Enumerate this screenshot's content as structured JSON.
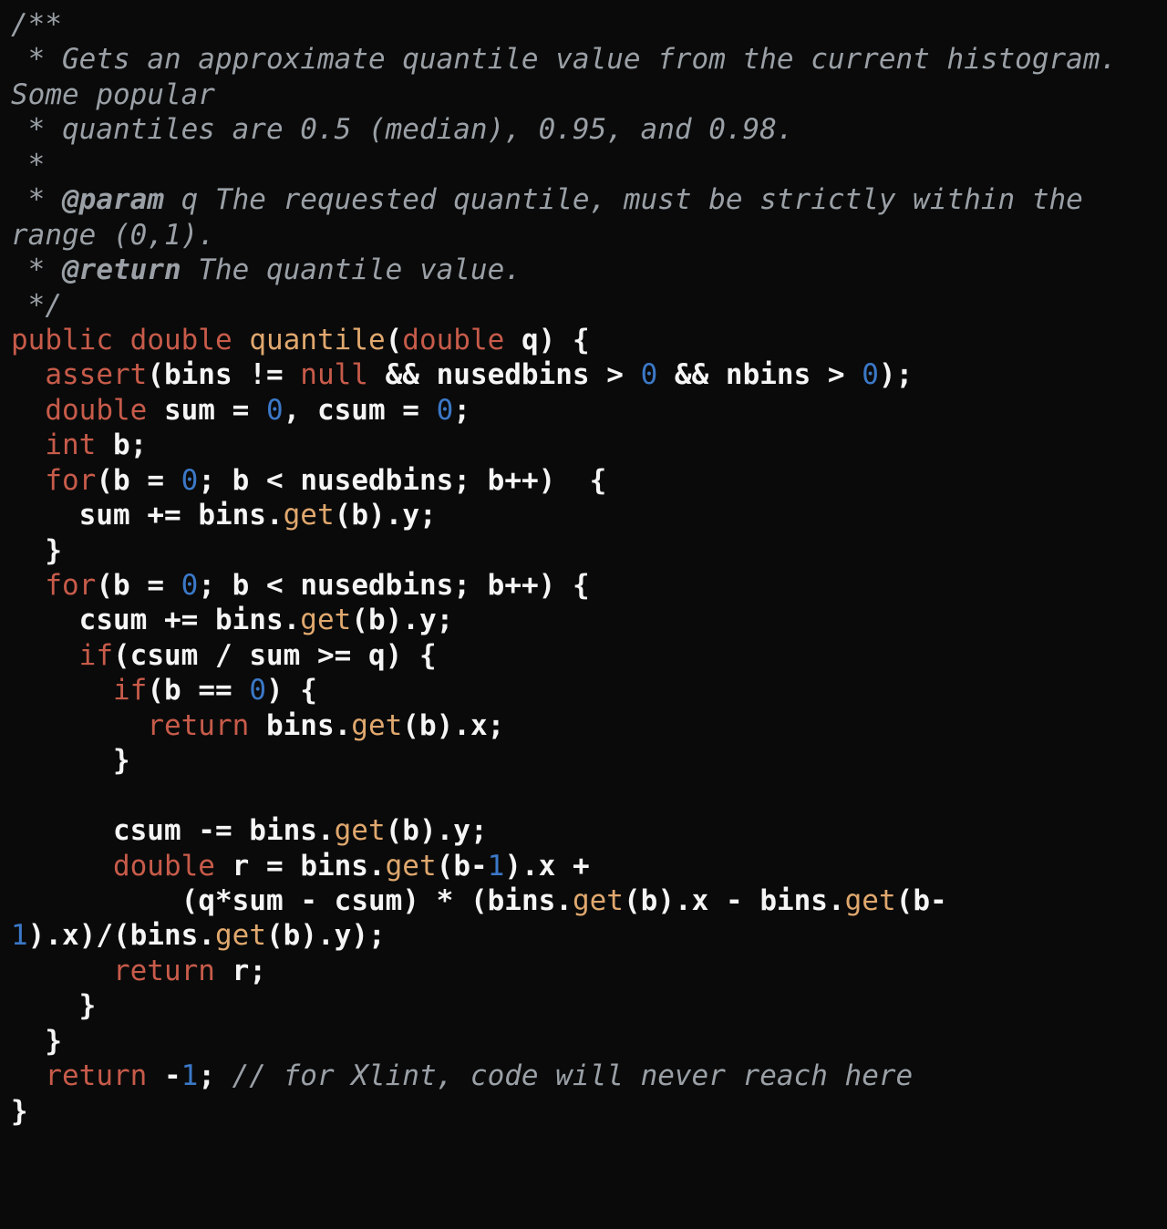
{
  "code": {
    "lang": "java",
    "theme": "dark",
    "colors": {
      "background": "#0a0a0a",
      "foreground": "#f5f5f5",
      "comment": "#9aa0a6",
      "keyword": "#c75b4a",
      "function": "#e0a86e",
      "number": "#3b78c7"
    },
    "source": "/**\n * Gets an approximate quantile value from the current histogram. Some popular\n * quantiles are 0.5 (median), 0.95, and 0.98.\n *\n * @param q The requested quantile, must be strictly within the range (0,1).\n * @return The quantile value.\n */\npublic double quantile(double q) {\n  assert(bins != null && nusedbins > 0 && nbins > 0);\n  double sum = 0, csum = 0;\n  int b;\n  for(b = 0; b < nusedbins; b++)  {\n    sum += bins.get(b).y;\n  }\n  for(b = 0; b < nusedbins; b++) {\n    csum += bins.get(b).y;\n    if(csum / sum >= q) {\n      if(b == 0) {\n        return bins.get(b).x;\n      }\n\n      csum -= bins.get(b).y;\n      double r = bins.get(b-1).x +\n          (q*sum - csum) * (bins.get(b).x - bins.get(b-1).x)/(bins.get(b).y);\n      return r;\n    }\n  }\n  return -1; // for Xlint, code will never reach here\n}",
    "tokens": [
      {
        "t": "/**",
        "c": "comment"
      },
      {
        "nl": 1
      },
      {
        "t": " * Gets an approximate quantile value from the current histogram. Some popular",
        "c": "comment"
      },
      {
        "nl": 1
      },
      {
        "t": " * quantiles are 0.5 (median), 0.95, and 0.98.",
        "c": "comment"
      },
      {
        "nl": 1
      },
      {
        "t": " *",
        "c": "comment"
      },
      {
        "nl": 1
      },
      {
        "t": " * ",
        "c": "comment"
      },
      {
        "t": "@param",
        "c": "tag"
      },
      {
        "t": " q The requested quantile, must be strictly within the range (0,1).",
        "c": "comment"
      },
      {
        "nl": 1
      },
      {
        "t": " * ",
        "c": "comment"
      },
      {
        "t": "@return",
        "c": "tag"
      },
      {
        "t": " The quantile value.",
        "c": "comment"
      },
      {
        "nl": 1
      },
      {
        "t": " */",
        "c": "comment"
      },
      {
        "nl": 1
      },
      {
        "t": "public",
        "c": "kw"
      },
      {
        "t": " ",
        "c": "plain"
      },
      {
        "t": "double",
        "c": "kw"
      },
      {
        "t": " ",
        "c": "plain"
      },
      {
        "t": "quantile",
        "c": "fn"
      },
      {
        "t": "(",
        "c": "op"
      },
      {
        "t": "double",
        "c": "kw"
      },
      {
        "t": " ",
        "c": "plain"
      },
      {
        "t": "q",
        "c": "id"
      },
      {
        "t": ") {",
        "c": "op"
      },
      {
        "nl": 1
      },
      {
        "t": "  ",
        "c": "plain"
      },
      {
        "t": "assert",
        "c": "kw"
      },
      {
        "t": "(",
        "c": "op"
      },
      {
        "t": "bins",
        "c": "id"
      },
      {
        "t": " != ",
        "c": "op"
      },
      {
        "t": "null",
        "c": "null"
      },
      {
        "t": " && ",
        "c": "op"
      },
      {
        "t": "nusedbins",
        "c": "id"
      },
      {
        "t": " > ",
        "c": "op"
      },
      {
        "t": "0",
        "c": "num"
      },
      {
        "t": " && ",
        "c": "op"
      },
      {
        "t": "nbins",
        "c": "id"
      },
      {
        "t": " > ",
        "c": "op"
      },
      {
        "t": "0",
        "c": "num"
      },
      {
        "t": ");",
        "c": "op"
      },
      {
        "nl": 1
      },
      {
        "t": "  ",
        "c": "plain"
      },
      {
        "t": "double",
        "c": "kw"
      },
      {
        "t": " ",
        "c": "plain"
      },
      {
        "t": "sum",
        "c": "id"
      },
      {
        "t": " = ",
        "c": "op"
      },
      {
        "t": "0",
        "c": "num"
      },
      {
        "t": ", ",
        "c": "op"
      },
      {
        "t": "csum",
        "c": "id"
      },
      {
        "t": " = ",
        "c": "op"
      },
      {
        "t": "0",
        "c": "num"
      },
      {
        "t": ";",
        "c": "op"
      },
      {
        "nl": 1
      },
      {
        "t": "  ",
        "c": "plain"
      },
      {
        "t": "int",
        "c": "kw"
      },
      {
        "t": " ",
        "c": "plain"
      },
      {
        "t": "b",
        "c": "id"
      },
      {
        "t": ";",
        "c": "op"
      },
      {
        "nl": 1
      },
      {
        "t": "  ",
        "c": "plain"
      },
      {
        "t": "for",
        "c": "kw"
      },
      {
        "t": "(",
        "c": "op"
      },
      {
        "t": "b",
        "c": "id"
      },
      {
        "t": " = ",
        "c": "op"
      },
      {
        "t": "0",
        "c": "num"
      },
      {
        "t": "; ",
        "c": "op"
      },
      {
        "t": "b",
        "c": "id"
      },
      {
        "t": " < ",
        "c": "op"
      },
      {
        "t": "nusedbins",
        "c": "id"
      },
      {
        "t": "; ",
        "c": "op"
      },
      {
        "t": "b",
        "c": "id"
      },
      {
        "t": "++)  {",
        "c": "op"
      },
      {
        "nl": 1
      },
      {
        "t": "    ",
        "c": "plain"
      },
      {
        "t": "sum",
        "c": "id"
      },
      {
        "t": " += ",
        "c": "op"
      },
      {
        "t": "bins",
        "c": "id"
      },
      {
        "t": ".",
        "c": "op"
      },
      {
        "t": "get",
        "c": "fn"
      },
      {
        "t": "(",
        "c": "op"
      },
      {
        "t": "b",
        "c": "id"
      },
      {
        "t": ").",
        "c": "op"
      },
      {
        "t": "y",
        "c": "id"
      },
      {
        "t": ";",
        "c": "op"
      },
      {
        "nl": 1
      },
      {
        "t": "  }",
        "c": "op"
      },
      {
        "nl": 1
      },
      {
        "t": "  ",
        "c": "plain"
      },
      {
        "t": "for",
        "c": "kw"
      },
      {
        "t": "(",
        "c": "op"
      },
      {
        "t": "b",
        "c": "id"
      },
      {
        "t": " = ",
        "c": "op"
      },
      {
        "t": "0",
        "c": "num"
      },
      {
        "t": "; ",
        "c": "op"
      },
      {
        "t": "b",
        "c": "id"
      },
      {
        "t": " < ",
        "c": "op"
      },
      {
        "t": "nusedbins",
        "c": "id"
      },
      {
        "t": "; ",
        "c": "op"
      },
      {
        "t": "b",
        "c": "id"
      },
      {
        "t": "++) {",
        "c": "op"
      },
      {
        "nl": 1
      },
      {
        "t": "    ",
        "c": "plain"
      },
      {
        "t": "csum",
        "c": "id"
      },
      {
        "t": " += ",
        "c": "op"
      },
      {
        "t": "bins",
        "c": "id"
      },
      {
        "t": ".",
        "c": "op"
      },
      {
        "t": "get",
        "c": "fn"
      },
      {
        "t": "(",
        "c": "op"
      },
      {
        "t": "b",
        "c": "id"
      },
      {
        "t": ").",
        "c": "op"
      },
      {
        "t": "y",
        "c": "id"
      },
      {
        "t": ";",
        "c": "op"
      },
      {
        "nl": 1
      },
      {
        "t": "    ",
        "c": "plain"
      },
      {
        "t": "if",
        "c": "kw"
      },
      {
        "t": "(",
        "c": "op"
      },
      {
        "t": "csum",
        "c": "id"
      },
      {
        "t": " / ",
        "c": "op"
      },
      {
        "t": "sum",
        "c": "id"
      },
      {
        "t": " >= ",
        "c": "op"
      },
      {
        "t": "q",
        "c": "id"
      },
      {
        "t": ") {",
        "c": "op"
      },
      {
        "nl": 1
      },
      {
        "t": "      ",
        "c": "plain"
      },
      {
        "t": "if",
        "c": "kw"
      },
      {
        "t": "(",
        "c": "op"
      },
      {
        "t": "b",
        "c": "id"
      },
      {
        "t": " == ",
        "c": "op"
      },
      {
        "t": "0",
        "c": "num"
      },
      {
        "t": ") {",
        "c": "op"
      },
      {
        "nl": 1
      },
      {
        "t": "        ",
        "c": "plain"
      },
      {
        "t": "return",
        "c": "kw"
      },
      {
        "t": " ",
        "c": "plain"
      },
      {
        "t": "bins",
        "c": "id"
      },
      {
        "t": ".",
        "c": "op"
      },
      {
        "t": "get",
        "c": "fn"
      },
      {
        "t": "(",
        "c": "op"
      },
      {
        "t": "b",
        "c": "id"
      },
      {
        "t": ").",
        "c": "op"
      },
      {
        "t": "x",
        "c": "id"
      },
      {
        "t": ";",
        "c": "op"
      },
      {
        "nl": 1
      },
      {
        "t": "      }",
        "c": "op"
      },
      {
        "nl": 1
      },
      {
        "nl": 1
      },
      {
        "t": "      ",
        "c": "plain"
      },
      {
        "t": "csum",
        "c": "id"
      },
      {
        "t": " -= ",
        "c": "op"
      },
      {
        "t": "bins",
        "c": "id"
      },
      {
        "t": ".",
        "c": "op"
      },
      {
        "t": "get",
        "c": "fn"
      },
      {
        "t": "(",
        "c": "op"
      },
      {
        "t": "b",
        "c": "id"
      },
      {
        "t": ").",
        "c": "op"
      },
      {
        "t": "y",
        "c": "id"
      },
      {
        "t": ";",
        "c": "op"
      },
      {
        "nl": 1
      },
      {
        "t": "      ",
        "c": "plain"
      },
      {
        "t": "double",
        "c": "kw"
      },
      {
        "t": " ",
        "c": "plain"
      },
      {
        "t": "r",
        "c": "id"
      },
      {
        "t": " = ",
        "c": "op"
      },
      {
        "t": "bins",
        "c": "id"
      },
      {
        "t": ".",
        "c": "op"
      },
      {
        "t": "get",
        "c": "fn"
      },
      {
        "t": "(",
        "c": "op"
      },
      {
        "t": "b",
        "c": "id"
      },
      {
        "t": "-",
        "c": "op"
      },
      {
        "t": "1",
        "c": "num"
      },
      {
        "t": ").",
        "c": "op"
      },
      {
        "t": "x",
        "c": "id"
      },
      {
        "t": " +",
        "c": "op"
      },
      {
        "nl": 1
      },
      {
        "t": "          (",
        "c": "op"
      },
      {
        "t": "q",
        "c": "id"
      },
      {
        "t": "*",
        "c": "op"
      },
      {
        "t": "sum",
        "c": "id"
      },
      {
        "t": " - ",
        "c": "op"
      },
      {
        "t": "csum",
        "c": "id"
      },
      {
        "t": ") * (",
        "c": "op"
      },
      {
        "t": "bins",
        "c": "id"
      },
      {
        "t": ".",
        "c": "op"
      },
      {
        "t": "get",
        "c": "fn"
      },
      {
        "t": "(",
        "c": "op"
      },
      {
        "t": "b",
        "c": "id"
      },
      {
        "t": ").",
        "c": "op"
      },
      {
        "t": "x",
        "c": "id"
      },
      {
        "t": " - ",
        "c": "op"
      },
      {
        "t": "bins",
        "c": "id"
      },
      {
        "t": ".",
        "c": "op"
      },
      {
        "t": "get",
        "c": "fn"
      },
      {
        "t": "(",
        "c": "op"
      },
      {
        "t": "b",
        "c": "id"
      },
      {
        "t": "-",
        "c": "op"
      },
      {
        "t": "1",
        "c": "num"
      },
      {
        "t": ").",
        "c": "op"
      },
      {
        "t": "x",
        "c": "id"
      },
      {
        "t": ")/(",
        "c": "op"
      },
      {
        "t": "bins",
        "c": "id"
      },
      {
        "t": ".",
        "c": "op"
      },
      {
        "t": "get",
        "c": "fn"
      },
      {
        "t": "(",
        "c": "op"
      },
      {
        "t": "b",
        "c": "id"
      },
      {
        "t": ").",
        "c": "op"
      },
      {
        "t": "y",
        "c": "id"
      },
      {
        "t": ");",
        "c": "op"
      },
      {
        "nl": 1
      },
      {
        "t": "      ",
        "c": "plain"
      },
      {
        "t": "return",
        "c": "kw"
      },
      {
        "t": " ",
        "c": "plain"
      },
      {
        "t": "r",
        "c": "id"
      },
      {
        "t": ";",
        "c": "op"
      },
      {
        "nl": 1
      },
      {
        "t": "    }",
        "c": "op"
      },
      {
        "nl": 1
      },
      {
        "t": "  }",
        "c": "op"
      },
      {
        "nl": 1
      },
      {
        "t": "  ",
        "c": "plain"
      },
      {
        "t": "return",
        "c": "kw"
      },
      {
        "t": " -",
        "c": "op"
      },
      {
        "t": "1",
        "c": "num"
      },
      {
        "t": "; ",
        "c": "op"
      },
      {
        "t": "// for Xlint, code will never reach here",
        "c": "comment"
      },
      {
        "nl": 1
      },
      {
        "t": "}",
        "c": "op"
      }
    ]
  }
}
